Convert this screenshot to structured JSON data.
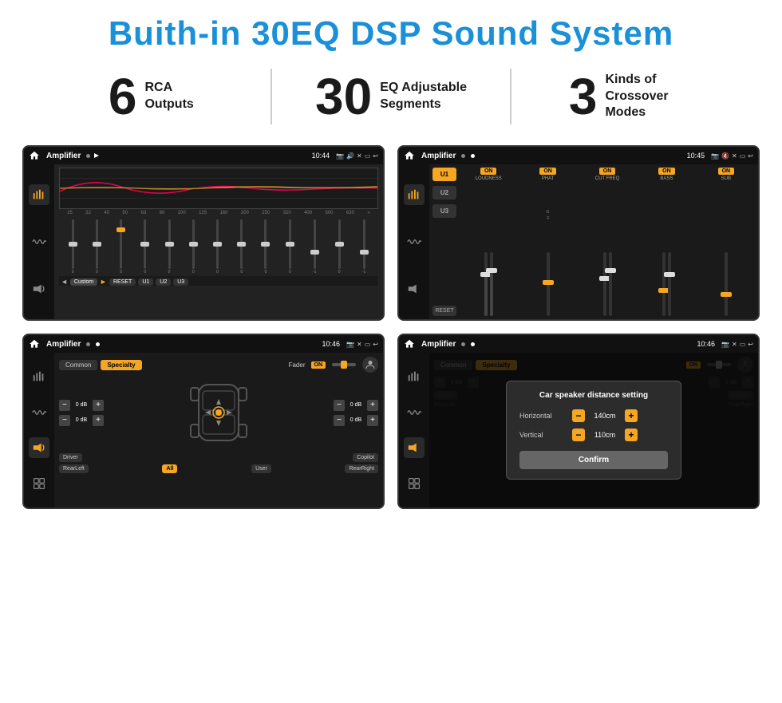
{
  "header": {
    "title": "Buith-in 30EQ DSP Sound System"
  },
  "stats": [
    {
      "number": "6",
      "label": "RCA\nOutputs"
    },
    {
      "number": "30",
      "label": "EQ Adjustable\nSegments"
    },
    {
      "number": "3",
      "label": "Kinds of\nCrossover Modes"
    }
  ],
  "screens": [
    {
      "id": "screen1",
      "title": "Amplifier",
      "time": "10:44",
      "type": "eq",
      "freqs": [
        "25",
        "32",
        "40",
        "50",
        "63",
        "80",
        "100",
        "125",
        "160",
        "200",
        "250",
        "320",
        "400",
        "500",
        "630"
      ],
      "slider_values": [
        "0",
        "0",
        "0",
        "5",
        "0",
        "0",
        "0",
        "0",
        "0",
        "0",
        "0",
        "-1",
        "0",
        "-1"
      ],
      "preset": "Custom",
      "buttons": [
        "◄",
        "Custom",
        "►",
        "RESET",
        "U1",
        "U2",
        "U3"
      ]
    },
    {
      "id": "screen2",
      "title": "Amplifier",
      "time": "10:45",
      "type": "crossover",
      "u_buttons": [
        "U1",
        "U2",
        "U3"
      ],
      "sections": [
        "LOUDNESS",
        "PHAT",
        "CUT FREQ",
        "BASS",
        "SUB"
      ],
      "on_status": [
        "ON",
        "ON",
        "ON",
        "ON",
        "ON"
      ]
    },
    {
      "id": "screen3",
      "title": "Amplifier",
      "time": "10:46",
      "type": "fader",
      "tabs": [
        "Common",
        "Specialty"
      ],
      "fader_label": "Fader",
      "fader_on": "ON",
      "volumes": [
        "0 dB",
        "0 dB",
        "0 dB",
        "0 dB"
      ],
      "buttons": [
        "Driver",
        "RearLeft",
        "All",
        "User",
        "Copilot",
        "RearRight"
      ]
    },
    {
      "id": "screen4",
      "title": "Amplifier",
      "time": "10:46",
      "type": "dialog",
      "tabs": [
        "Common",
        "Specialty"
      ],
      "dialog": {
        "title": "Car speaker distance setting",
        "horizontal_label": "Horizontal",
        "horizontal_val": "140cm",
        "vertical_label": "Vertical",
        "vertical_val": "110cm",
        "confirm_label": "Confirm"
      },
      "volumes": [
        "0 dB",
        "0 dB"
      ],
      "buttons": [
        "Driver",
        "RearLeft",
        "All",
        "User",
        "Copilot",
        "RearRight"
      ]
    }
  ]
}
